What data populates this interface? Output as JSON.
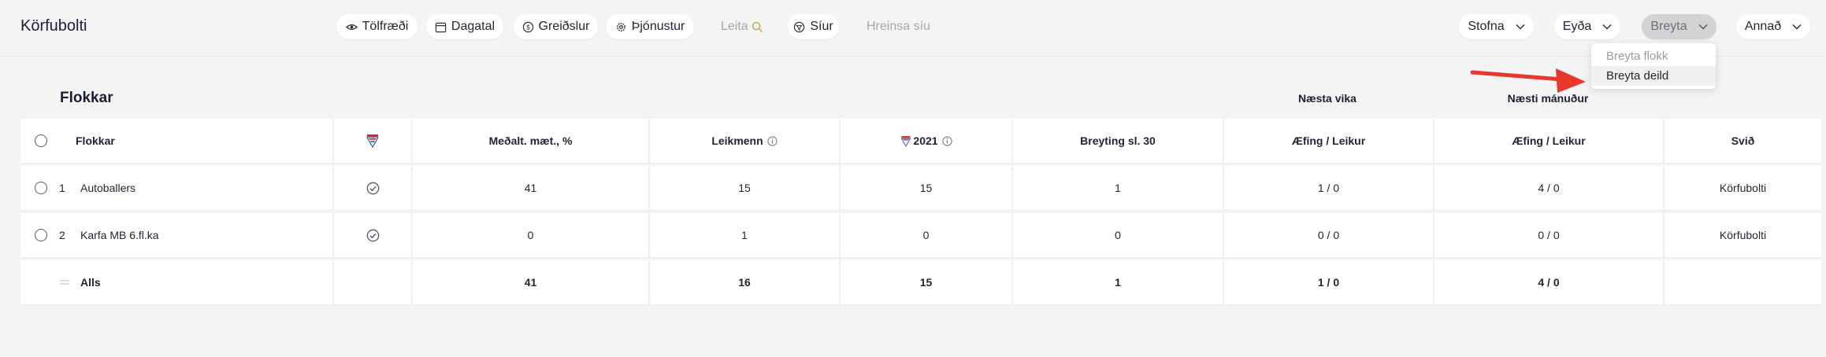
{
  "app": {
    "title": "Körfubolti"
  },
  "nav": {
    "tolfraedi": "Tölfræði",
    "dagatal": "Dagatal",
    "greidslur": "Greiðslur",
    "thjonustur": "Þjónustur",
    "search_label": "Leita",
    "siur": "Síur",
    "hreinsa": "Hreinsa síu"
  },
  "actions": {
    "stofna": "Stofna",
    "eyda": "Eyða",
    "breyta": "Breyta",
    "annad": "Annað"
  },
  "menu": {
    "items": [
      "Breyta flokk",
      "Breyta deild"
    ]
  },
  "section": {
    "title": "Flokkar",
    "next_week": "Næsta vika",
    "next_month": "Næsti mánuður"
  },
  "table": {
    "headers": {
      "flokkar": "Flokkar",
      "mean": "Meðalt. mæt., %",
      "players": "Leikmenn",
      "year": "2021",
      "change": "Breyting sl. 30",
      "week": "Æfing / Leikur",
      "month": "Æfing / Leikur",
      "svid": "Svið"
    },
    "rows": [
      {
        "index": "1",
        "name": "Autoballers",
        "mean": "41",
        "players": "15",
        "year": "15",
        "change": "1",
        "week": "1 / 0",
        "month": "4 / 0",
        "svid": "Körfubolti"
      },
      {
        "index": "2",
        "name": "Karfa MB 6.fl.ka",
        "mean": "0",
        "players": "1",
        "year": "0",
        "change": "0",
        "week": "0 / 0",
        "month": "0 / 0",
        "svid": "Körfubolti"
      }
    ],
    "total": {
      "label": "Alls",
      "mean": "41",
      "players": "16",
      "year": "15",
      "change": "1",
      "week": "1 / 0",
      "month": "4 / 0"
    }
  },
  "colors": {
    "accent_arrow": "#e8372b",
    "background": "#f4f4f4",
    "active_button": "#d3d3d6"
  }
}
